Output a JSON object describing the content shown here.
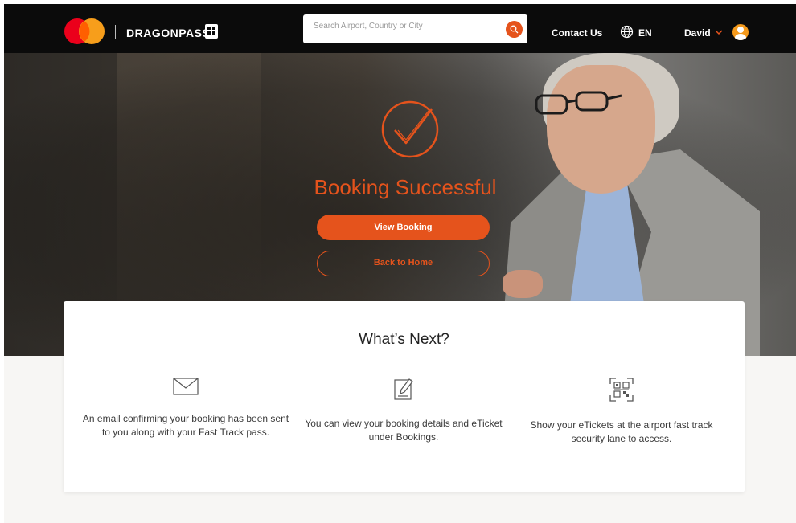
{
  "header": {
    "brand_name": "DRAGONPASS",
    "search_placeholder": "Search Airport, Country or City",
    "contact_label": "Contact Us",
    "language_label": "EN",
    "user_name": "David"
  },
  "hero": {
    "title": "Booking Successful",
    "view_booking_label": "View Booking",
    "back_home_label": "Back to Home"
  },
  "next": {
    "title": "What’s Next?",
    "steps": [
      {
        "icon": "envelope-icon",
        "text": "An email confirming your booking has been sent to you along with your Fast Track pass."
      },
      {
        "icon": "edit-document-icon",
        "text": "You can view your booking details and eTicket under Bookings."
      },
      {
        "icon": "qr-code-icon",
        "text": "Show your eTickets at the airport fast track security lane to access."
      }
    ]
  },
  "colors": {
    "accent": "#e5531c",
    "header_bg": "#0b0b0b",
    "page_bg": "#f7f6f4"
  }
}
